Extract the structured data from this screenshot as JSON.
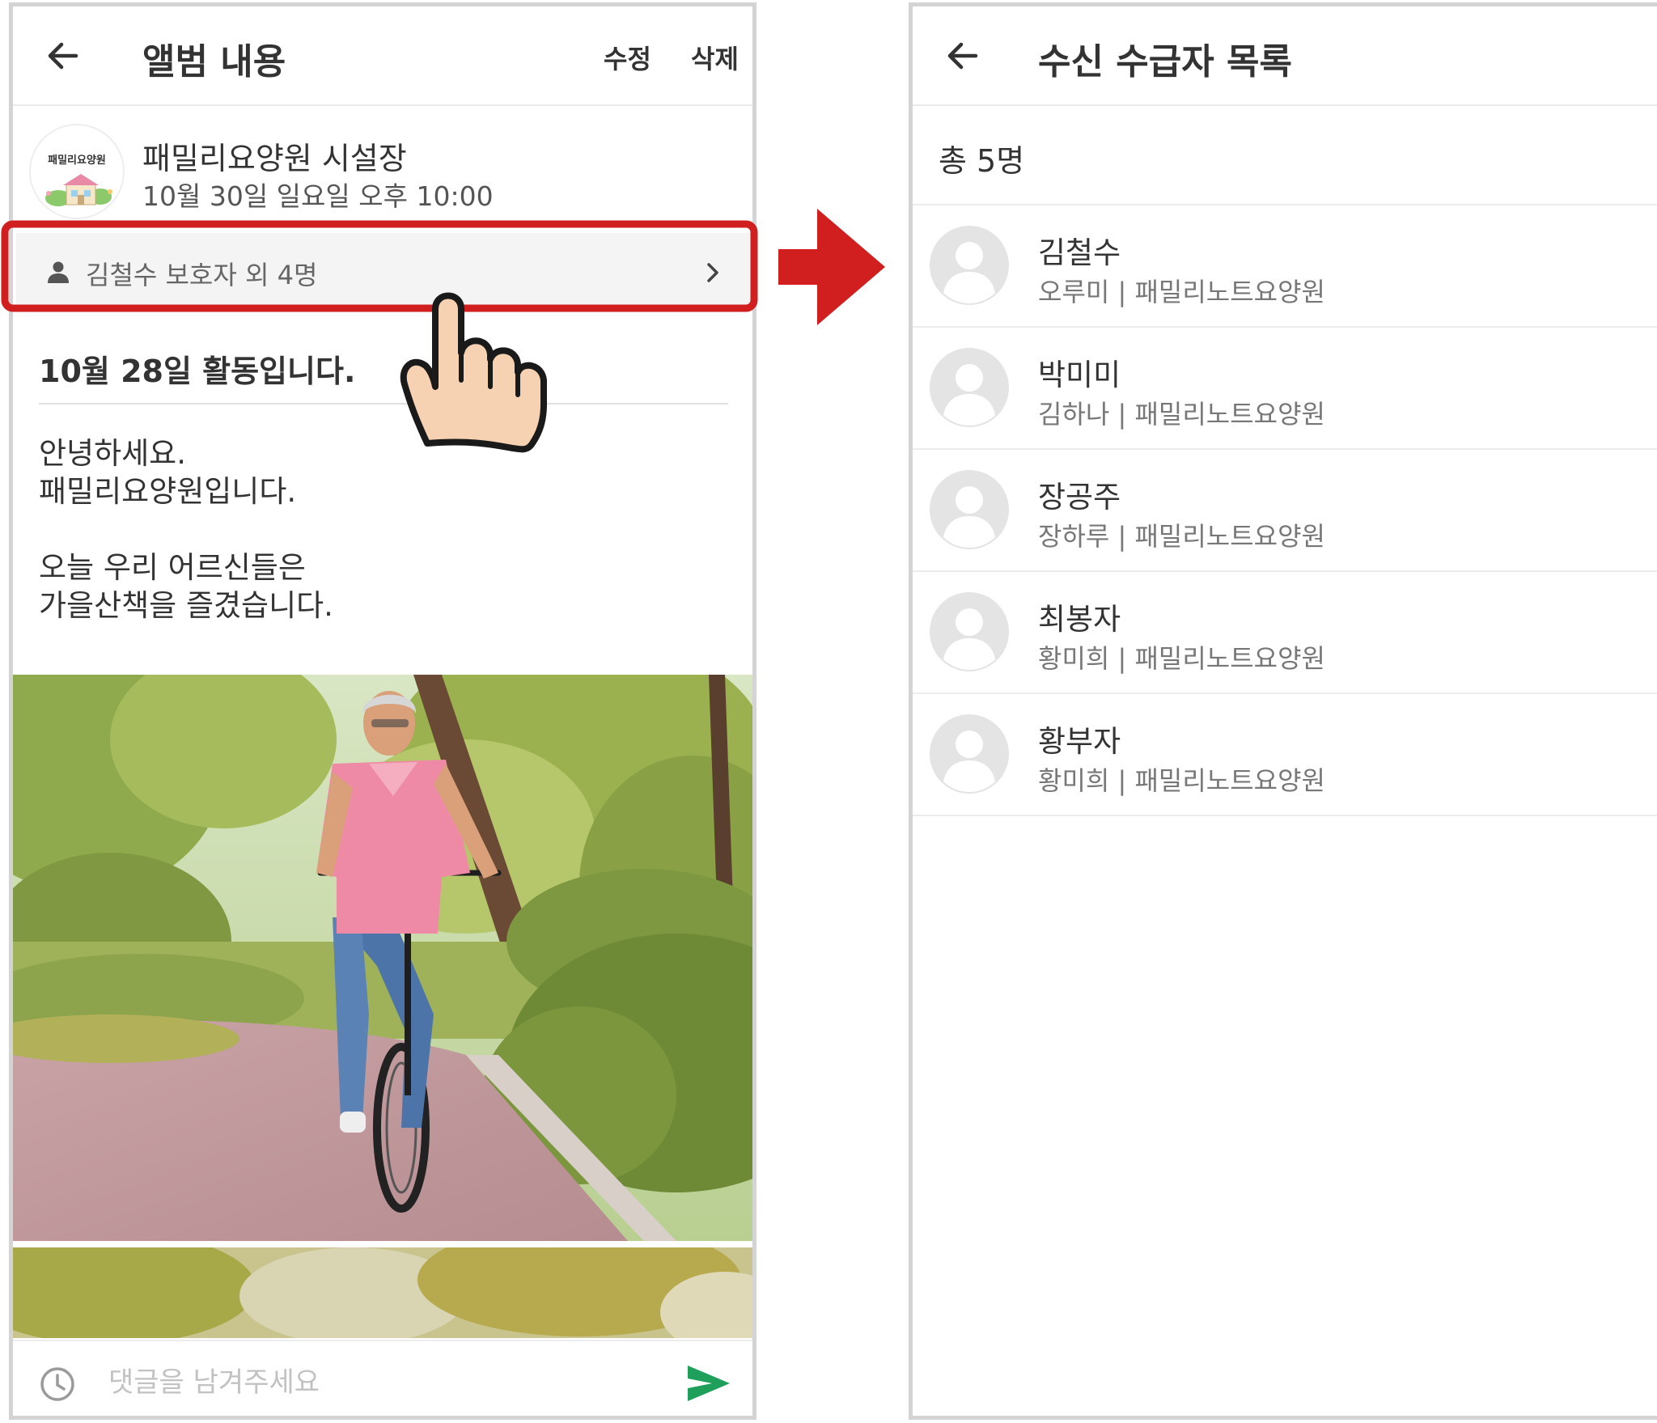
{
  "left_screen": {
    "header": {
      "title": "앨범 내용",
      "edit_label": "수정",
      "delete_label": "삭제"
    },
    "facility": {
      "logo_text": "패밀리요양원",
      "name": "패밀리요양원 시설장",
      "datetime": "10월 30일 일요일 오후 10:00"
    },
    "recipients_summary": "김철수 보호자 외 4명",
    "post": {
      "title": "10월 28일 활동입니다.",
      "lines": [
        "안녕하세요.",
        "패밀리요양원입니다.",
        "",
        "오늘 우리 어르신들은",
        "가을산책을 즐겼습니다."
      ]
    },
    "comment": {
      "placeholder": "댓글을 남겨주세요"
    }
  },
  "right_screen": {
    "header": {
      "title": "수신 수급자 목록"
    },
    "total": "총 5명",
    "recipients": [
      {
        "name": "김철수",
        "sub": "오루미 | 패밀리노트요양원"
      },
      {
        "name": "박미미",
        "sub": "김하나 | 패밀리노트요양원"
      },
      {
        "name": "장공주",
        "sub": "장하루 | 패밀리노트요양원"
      },
      {
        "name": "최봉자",
        "sub": "황미희 | 패밀리노트요양원"
      },
      {
        "name": "황부자",
        "sub": "황미희 | 패밀리노트요양원"
      }
    ]
  },
  "colors": {
    "highlight_red": "#d11f1f",
    "send_green": "#1fa05a",
    "hand_fill": "#f6d2b2"
  },
  "icons": [
    "back-arrow-icon",
    "person-icon",
    "chevron-right-icon",
    "clock-icon",
    "send-icon",
    "avatar-placeholder-icon",
    "pointing-hand-icon",
    "right-arrow-icon"
  ]
}
